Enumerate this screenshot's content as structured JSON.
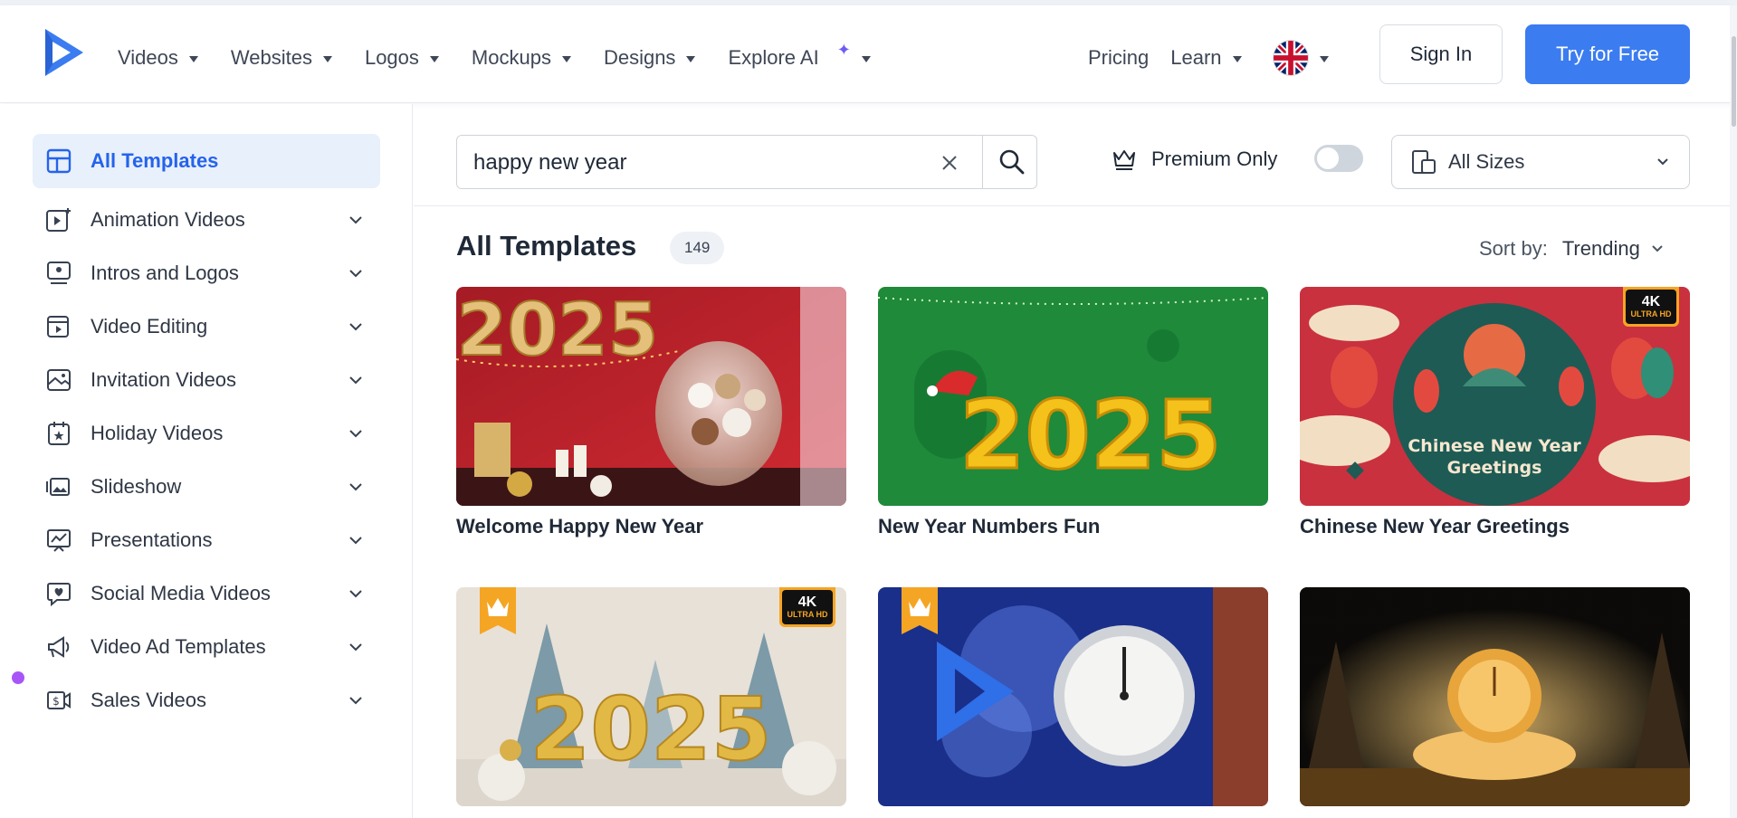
{
  "header": {
    "nav": [
      {
        "label": "Videos",
        "icon": "caret-down-icon"
      },
      {
        "label": "Websites",
        "icon": "caret-down-icon"
      },
      {
        "label": "Logos",
        "icon": "caret-down-icon"
      },
      {
        "label": "Mockups",
        "icon": "caret-down-icon"
      },
      {
        "label": "Designs",
        "icon": "caret-down-icon"
      },
      {
        "label": "Explore AI",
        "icon": "sparkle-icon"
      }
    ],
    "pricing": "Pricing",
    "learn": "Learn",
    "signin": "Sign In",
    "try": "Try for Free"
  },
  "sidebar": {
    "items": [
      {
        "label": "All Templates",
        "icon": "template-grid-icon",
        "active": true
      },
      {
        "label": "Animation Videos",
        "icon": "animation-video-icon"
      },
      {
        "label": "Intros and Logos",
        "icon": "intro-logo-icon"
      },
      {
        "label": "Video Editing",
        "icon": "video-edit-icon"
      },
      {
        "label": "Invitation Videos",
        "icon": "invitation-icon"
      },
      {
        "label": "Holiday Videos",
        "icon": "calendar-star-icon"
      },
      {
        "label": "Slideshow",
        "icon": "slideshow-icon"
      },
      {
        "label": "Presentations",
        "icon": "presentation-chart-icon"
      },
      {
        "label": "Social Media Videos",
        "icon": "heart-chat-icon"
      },
      {
        "label": "Video Ad Templates",
        "icon": "megaphone-icon"
      },
      {
        "label": "Sales Videos",
        "icon": "dollar-video-icon"
      }
    ]
  },
  "toolbar": {
    "search_value": "happy new year",
    "premium_label": "Premium Only",
    "premium_on": false,
    "sizes_label": "All Sizes"
  },
  "main": {
    "title": "All Templates",
    "count": "149",
    "sort_label": "Sort by:",
    "sort_value": "Trending",
    "cards": [
      {
        "title": "Welcome Happy New Year",
        "badge_4k": false,
        "premium": false
      },
      {
        "title": "New Year Numbers Fun",
        "badge_4k": false,
        "premium": false
      },
      {
        "title": "Chinese New Year Greetings",
        "badge_4k": true,
        "premium": false
      },
      {
        "title": "",
        "badge_4k": true,
        "premium": true
      },
      {
        "title": "",
        "badge_4k": false,
        "premium": true
      },
      {
        "title": "",
        "badge_4k": false,
        "premium": false
      }
    ],
    "badge_4k_top": "4K",
    "badge_4k_bottom": "ULTRA HD"
  },
  "thumb_text": {
    "year": "2025",
    "chinese_line1": "Chinese New Year",
    "chinese_line2": "Greetings"
  },
  "colors": {
    "accent": "#3b7cf0",
    "active_bg": "#e8f0fc",
    "active_text": "#2563eb",
    "badge_gold": "#f5a524"
  }
}
